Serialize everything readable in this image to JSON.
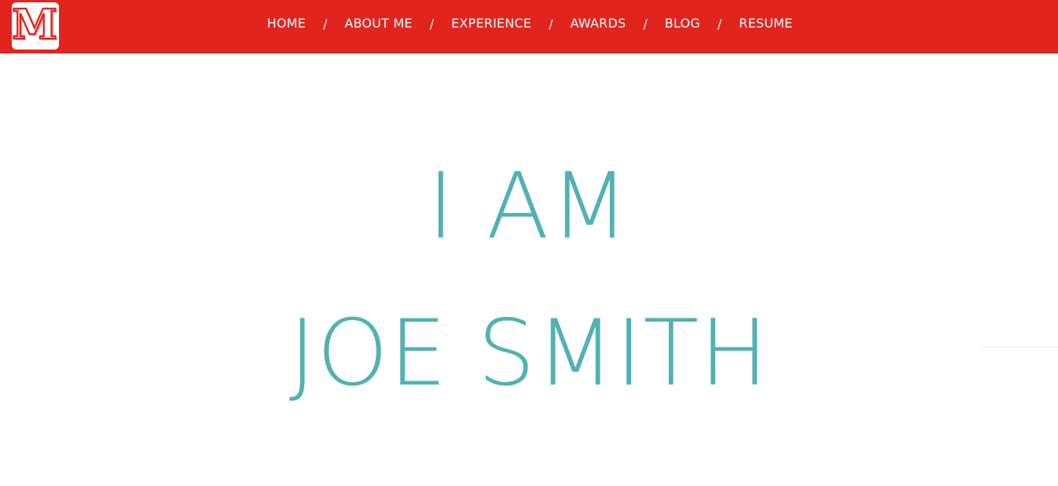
{
  "header": {
    "logo_icon": "letter-m-logo-icon",
    "logo_letter": "M",
    "background_color": "#e1251e",
    "nav": [
      {
        "label": "HOME"
      },
      {
        "label": "ABOUT ME"
      },
      {
        "label": "EXPERIENCE"
      },
      {
        "label": "AWARDS"
      },
      {
        "label": "BLOG"
      },
      {
        "label": "RESUME"
      }
    ],
    "separator": "/"
  },
  "hero": {
    "line1": "I AM",
    "line2": "JOE SMITH",
    "color": "#52b2b3"
  }
}
